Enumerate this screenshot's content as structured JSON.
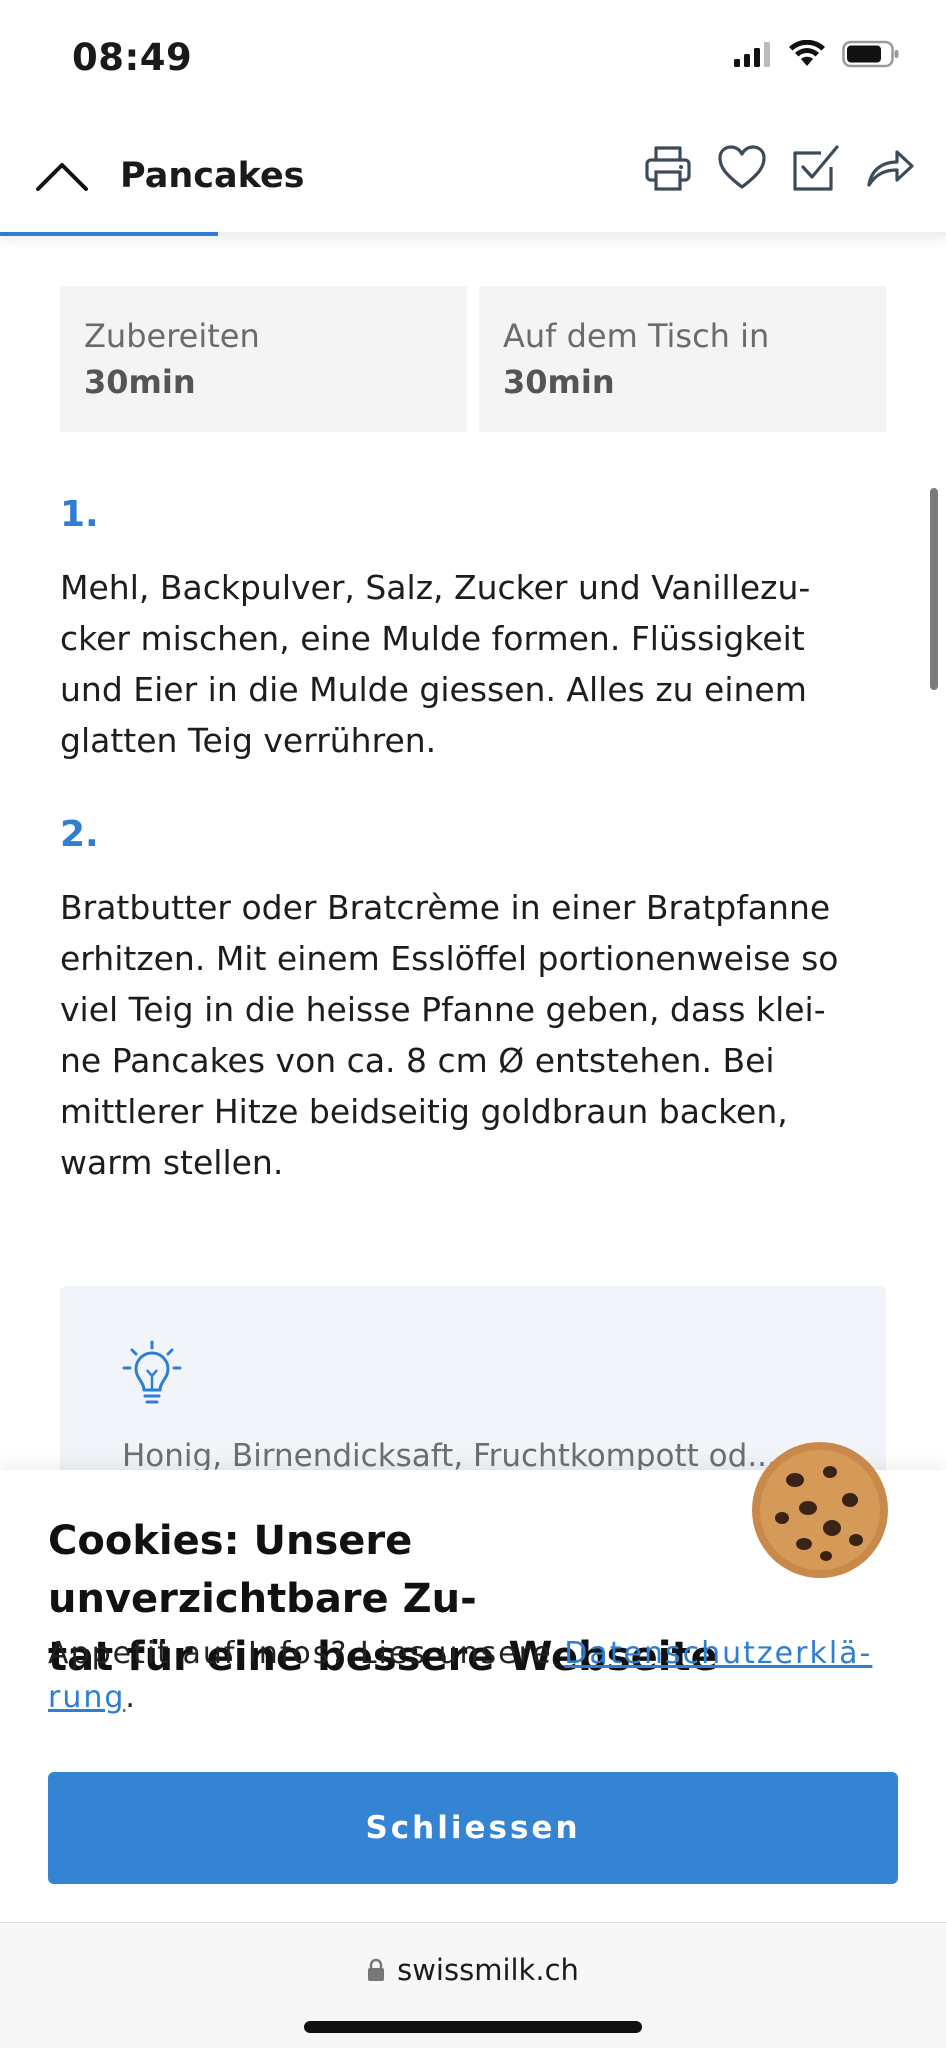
{
  "status_bar": {
    "time": "08:49"
  },
  "header": {
    "title": "Pancakes",
    "reading_progress": 0.23,
    "actions": [
      "printer-icon",
      "heart-icon",
      "checkbox-icon",
      "share-icon"
    ]
  },
  "times": {
    "prep_label": "Zubereiten",
    "prep_value": "30min",
    "table_label": "Auf dem Tisch in",
    "table_value": "30min"
  },
  "steps": [
    {
      "number": "1.",
      "lines": [
        "Mehl, Backpulver, Salz, Zucker und Vanillezu-",
        "cker mischen, eine Mulde formen. Flüssigkeit",
        "und Eier in die Mulde giessen. Alles zu einem",
        "glatten Teig verrühren."
      ]
    },
    {
      "number": "2.",
      "lines": [
        "Bratbutter oder Bratcrème in einer Bratpfanne",
        "erhitzen. Mit einem Esslöffel portionenweise so",
        "viel Teig in die heisse Pfanne geben, dass klei-",
        "ne Pancakes von ca. 8 cm Ø entstehen. Bei",
        "mittlerer Hitze beidseitig goldbraun backen,",
        "warm stellen."
      ]
    }
  ],
  "tip": {
    "text": "Honig, Birnendicksaft, Fruchtkompott od..."
  },
  "cookie_banner": {
    "title_line1": "Cookies: Unsere unverzichtbare Zu-",
    "title_line2": "tat für eine bessere Webseite",
    "body_prefix": "Appetit auf Infos? Lies unsere ",
    "link_part1": "Datenschutzerklä-",
    "link_part2": "rung",
    "body_suffix": ".",
    "close_label": "Schliessen"
  },
  "url_bar": {
    "domain": "swissmilk.ch"
  },
  "colors": {
    "accent": "#2f7fd1",
    "button": "#3584d4",
    "tip_bg": "#f1f5f9",
    "time_box_bg": "#f4f4f4"
  }
}
